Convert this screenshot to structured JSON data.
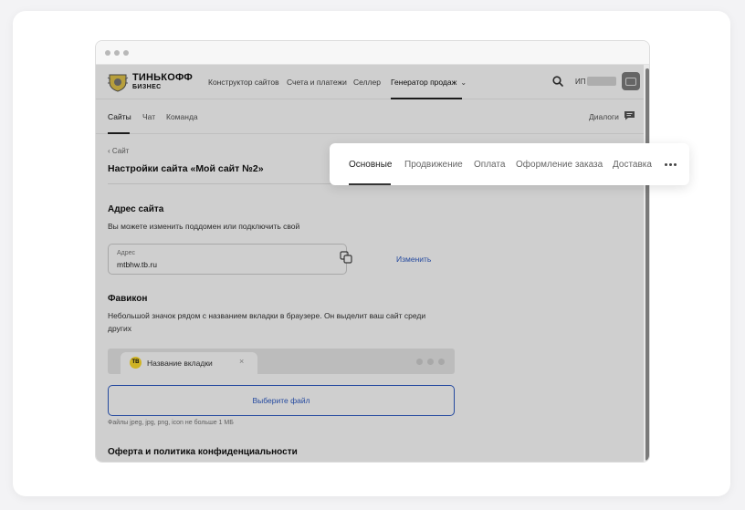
{
  "brand": {
    "line1": "ТИНЬКОФФ",
    "line2": "БИЗНЕС"
  },
  "topnav": {
    "items": [
      "Конструктор сайтов",
      "Счета и платежи",
      "Селлер",
      "Генератор продаж"
    ],
    "user_label": "ИП"
  },
  "subnav": {
    "items": [
      "Сайты",
      "Чат",
      "Команда"
    ],
    "dialogs": "Диалоги"
  },
  "page": {
    "back": "Сайт",
    "title": "Настройки сайта «Мой сайт №2»"
  },
  "address": {
    "heading": "Адрес сайта",
    "description": "Вы можете изменить поддомен или подключить свой",
    "field_label": "Адрес",
    "field_value": "mtbhw.tb.ru",
    "change_link": "Изменить"
  },
  "favicon": {
    "heading": "Фавикон",
    "description_line1": "Небольшой значок рядом с названием вкладки в браузере. Он выделит ваш сайт среди",
    "description_line2": "других",
    "badge": "ТВ",
    "tab_title": "Название вкладки",
    "tab_close": "×",
    "button": "Выберите файл",
    "hint": "Файлы jpeg, jpg, png, icon не больше 1 МБ"
  },
  "offer": {
    "heading": "Оферта и политика конфиденциальности"
  },
  "settings_tabs": {
    "items": [
      "Основные",
      "Продвижение",
      "Оплата",
      "Оформление заказа",
      "Доставка"
    ],
    "active": "Основные"
  },
  "colors": {
    "accent": "#2d5bc4",
    "brand_yellow": "#ffdd2d",
    "overlay": "rgba(0,0,0,0.19)"
  }
}
